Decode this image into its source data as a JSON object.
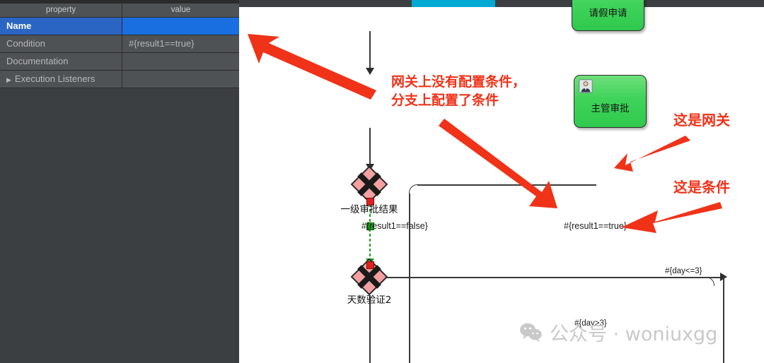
{
  "panel": {
    "headers": {
      "property": "property",
      "value": "value"
    },
    "rows": [
      {
        "property": "Name",
        "value": "",
        "selected": true,
        "expandable": false
      },
      {
        "property": "Condition",
        "value": "#{result1==true}",
        "selected": false,
        "expandable": false
      },
      {
        "property": "Documentation",
        "value": "",
        "selected": false,
        "expandable": false
      },
      {
        "property": "Execution Listeners",
        "value": "",
        "selected": false,
        "expandable": true
      }
    ],
    "expander_glyph": "▶"
  },
  "canvas": {
    "accent_color": "#00a8d2",
    "nodes": [
      {
        "id": "start-task",
        "label": "请假申请",
        "type": "user-task"
      },
      {
        "id": "manager-task",
        "label": "主管审批",
        "type": "user-task"
      },
      {
        "id": "gateway-1",
        "label": "一级审批结果",
        "type": "exclusive-gateway"
      },
      {
        "id": "gateway-2",
        "label": "天数验证2",
        "type": "exclusive-gateway"
      }
    ],
    "flow_labels": [
      {
        "id": "flow-false",
        "text": "#{result1==false}"
      },
      {
        "id": "flow-true",
        "text": "#{result1==true}"
      },
      {
        "id": "flow-day-lte3",
        "text": "#{day<=3}"
      },
      {
        "id": "flow-day-gt3",
        "text": "#{day>3}"
      }
    ]
  },
  "annotations": [
    {
      "id": "note-gateway-condition",
      "line1": "网关上没有配置条件，",
      "line2": "分支上配置了条件"
    },
    {
      "id": "note-this-is-gateway",
      "line1": "这是网关",
      "line2": ""
    },
    {
      "id": "note-this-is-condition",
      "line1": "这是条件",
      "line2": ""
    }
  ],
  "watermark": {
    "text": "公众号 · woniuxgg",
    "icon": "wechat-icon"
  },
  "colors": {
    "accent": "#00a8d2",
    "selection_blue": "#1a6fe0",
    "panel_bg": "#4e5254",
    "annotation_red": "#f03218",
    "task_green": "#3fd35a",
    "gateway_pink": "#f09a9a"
  }
}
